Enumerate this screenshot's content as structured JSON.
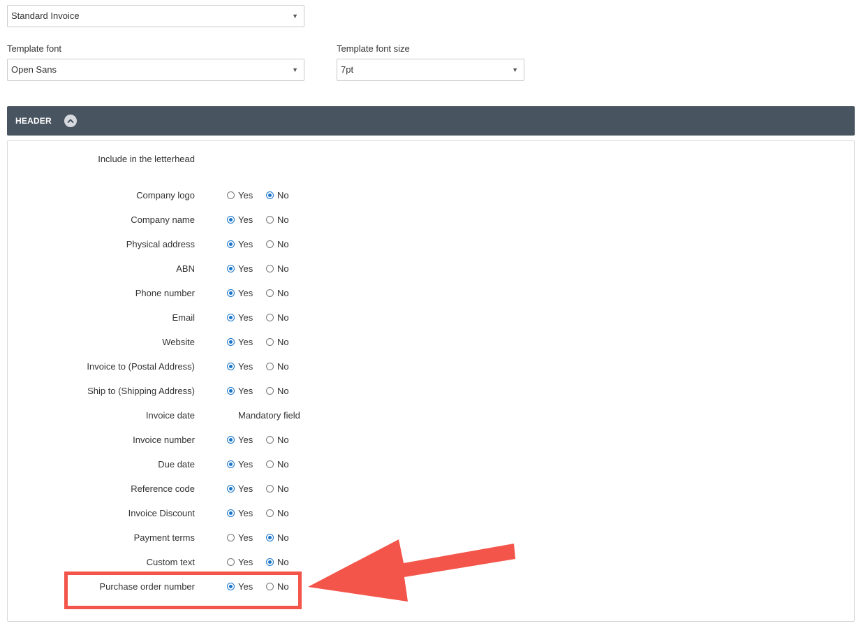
{
  "template_select": {
    "value": "Standard Invoice"
  },
  "font": {
    "label": "Template font",
    "value": "Open Sans"
  },
  "font_size": {
    "label": "Template font size",
    "value": "7pt"
  },
  "header_section": {
    "title": "HEADER",
    "intro": "Include in the letterhead",
    "rows": [
      {
        "label": "Company logo",
        "yes_label": "Yes",
        "no_label": "No",
        "selected": "no"
      },
      {
        "label": "Company name",
        "yes_label": "Yes",
        "no_label": "No",
        "selected": "yes"
      },
      {
        "label": "Physical address",
        "yes_label": "Yes",
        "no_label": "No",
        "selected": "yes"
      },
      {
        "label": "ABN",
        "yes_label": "Yes",
        "no_label": "No",
        "selected": "yes"
      },
      {
        "label": "Phone number",
        "yes_label": "Yes",
        "no_label": "No",
        "selected": "yes"
      },
      {
        "label": "Email",
        "yes_label": "Yes",
        "no_label": "No",
        "selected": "yes"
      },
      {
        "label": "Website",
        "yes_label": "Yes",
        "no_label": "No",
        "selected": "yes"
      },
      {
        "label": "Invoice to (Postal Address)",
        "yes_label": "Yes",
        "no_label": "No",
        "selected": "yes"
      },
      {
        "label": "Ship to (Shipping Address)",
        "yes_label": "Yes",
        "no_label": "No",
        "selected": "yes"
      },
      {
        "label": "Invoice date",
        "mandatory": "Mandatory field"
      },
      {
        "label": "Invoice number",
        "yes_label": "Yes",
        "no_label": "No",
        "selected": "yes"
      },
      {
        "label": "Due date",
        "yes_label": "Yes",
        "no_label": "No",
        "selected": "yes"
      },
      {
        "label": "Reference code",
        "yes_label": "Yes",
        "no_label": "No",
        "selected": "yes"
      },
      {
        "label": "Invoice Discount",
        "yes_label": "Yes",
        "no_label": "No",
        "selected": "yes"
      },
      {
        "label": "Payment terms",
        "yes_label": "Yes",
        "no_label": "No",
        "selected": "no"
      },
      {
        "label": "Custom text",
        "yes_label": "Yes",
        "no_label": "No",
        "selected": "no"
      },
      {
        "label": "Purchase order number",
        "yes_label": "Yes",
        "no_label": "No",
        "selected": "yes"
      }
    ]
  },
  "colors": {
    "section_bar": "#485460",
    "radio_selected": "#1a75c9",
    "annotation": "#f4554a"
  },
  "icons": {
    "dropdown": "caret-down-icon",
    "collapse": "chevron-up-icon",
    "annotation_arrow": "arrow-left-icon"
  }
}
